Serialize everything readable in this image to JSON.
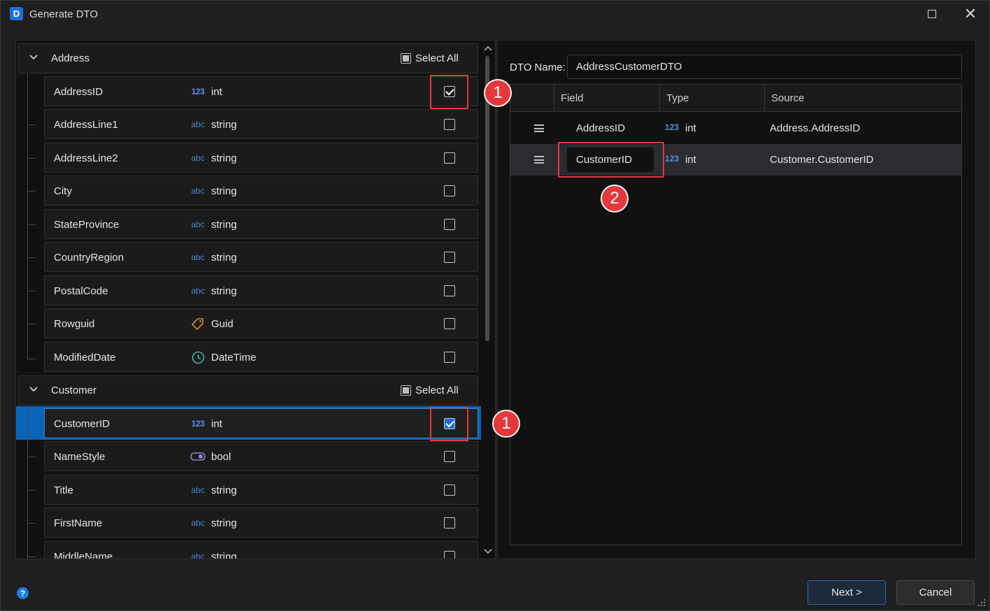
{
  "window": {
    "title": "Generate DTO",
    "app_logo_letter": "D"
  },
  "left": {
    "groups": [
      {
        "label": "Address",
        "select_all": "Select All",
        "fields": [
          {
            "name": "AddressID",
            "type": "int",
            "icon": "123",
            "checked": true
          },
          {
            "name": "AddressLine1",
            "type": "string",
            "icon": "abc",
            "checked": false
          },
          {
            "name": "AddressLine2",
            "type": "string",
            "icon": "abc",
            "checked": false
          },
          {
            "name": "City",
            "type": "string",
            "icon": "abc",
            "checked": false
          },
          {
            "name": "StateProvince",
            "type": "string",
            "icon": "abc",
            "checked": false
          },
          {
            "name": "CountryRegion",
            "type": "string",
            "icon": "abc",
            "checked": false
          },
          {
            "name": "PostalCode",
            "type": "string",
            "icon": "abc",
            "checked": false
          },
          {
            "name": "Rowguid",
            "type": "Guid",
            "icon": "tag-icon",
            "checked": false
          },
          {
            "name": "ModifiedDate",
            "type": "DateTime",
            "icon": "clock-icon",
            "checked": false
          }
        ]
      },
      {
        "label": "Customer",
        "select_all": "Select All",
        "fields": [
          {
            "name": "CustomerID",
            "type": "int",
            "icon": "123",
            "checked": true,
            "selected": true
          },
          {
            "name": "NameStyle",
            "type": "bool",
            "icon": "toggle-icon",
            "checked": false
          },
          {
            "name": "Title",
            "type": "string",
            "icon": "abc",
            "checked": false
          },
          {
            "name": "FirstName",
            "type": "string",
            "icon": "abc",
            "checked": false
          },
          {
            "name": "MiddleName",
            "type": "string",
            "icon": "abc",
            "checked": false
          }
        ]
      }
    ]
  },
  "right": {
    "dto_label": "DTO Name:",
    "dto_name": "AddressCustomerDTO",
    "columns": [
      "Field",
      "Type",
      "Source"
    ],
    "rows": [
      {
        "field": "AddressID",
        "type_icon": "123",
        "type": "int",
        "source": "Address.AddressID"
      },
      {
        "field": "CustomerID",
        "type_icon": "123",
        "type": "int",
        "source": "Customer.CustomerID"
      }
    ]
  },
  "callouts": {
    "one": "1",
    "two": "2"
  },
  "footer": {
    "help": "?",
    "next": "Next >",
    "cancel": "Cancel"
  },
  "colors": {
    "accent": "#0a64b8",
    "callout": "#e5383d",
    "background": "#1f1f1f"
  }
}
